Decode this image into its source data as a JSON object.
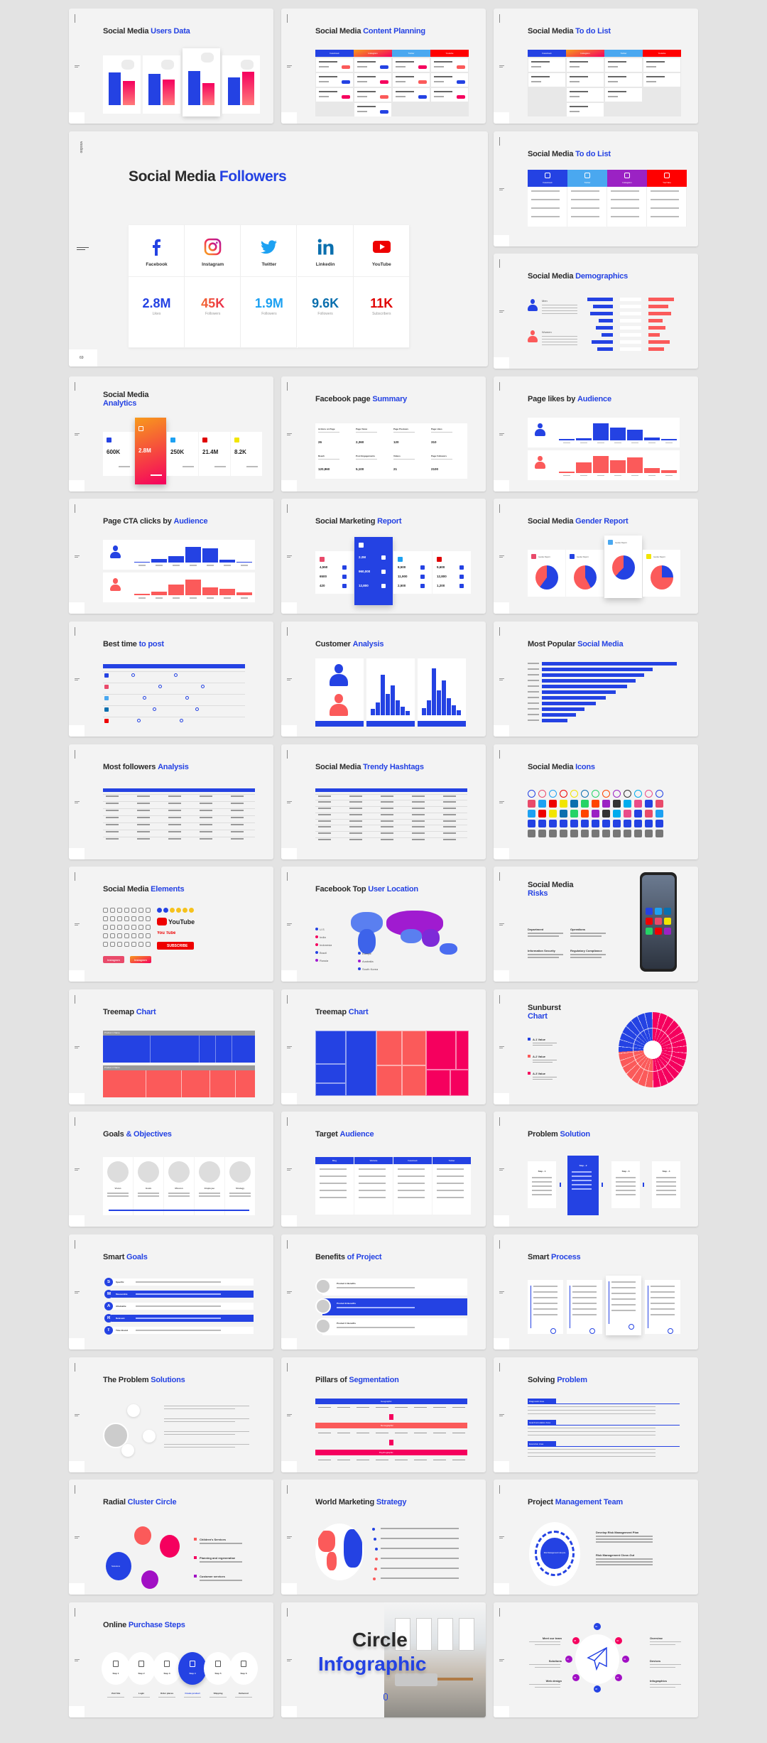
{
  "colors": {
    "blue": "#2442e3",
    "red": "#fb5a5a",
    "pink": "#f5005e",
    "purple": "#a10fc4",
    "light_blue": "#4aa8f0",
    "youtube": "#ee0000",
    "background": "#e3e3e3",
    "slide": "#f3f3f3"
  },
  "featured": {
    "brand": "voodoo",
    "page_number": "69",
    "title": [
      "Social Media ",
      "Followers"
    ],
    "networks": [
      {
        "name": "Facebook",
        "value": "2.8M",
        "unit": "Likes",
        "icon": "facebook-icon",
        "color": "#2442e3"
      },
      {
        "name": "Instagram",
        "value": "45K",
        "unit": "Followers",
        "icon": "instagram-icon",
        "color": "#f2473f"
      },
      {
        "name": "Twitter",
        "value": "1.9M",
        "unit": "Followers",
        "icon": "twitter-icon",
        "color": "#1da1f2"
      },
      {
        "name": "Linkedin",
        "value": "9.6K",
        "unit": "Followers",
        "icon": "linkedin-icon",
        "color": "#0a6fae"
      },
      {
        "name": "YouTube",
        "value": "11K",
        "unit": "Subscribers",
        "icon": "youtube-icon",
        "color": "#e00000"
      }
    ]
  },
  "slides": [
    {
      "type": "users",
      "title": [
        "Social Media ",
        "Users Data"
      ],
      "levels": [
        [
          0.82,
          0.6
        ],
        [
          0.78,
          0.64
        ],
        [
          0.85,
          0.55
        ],
        [
          0.7,
          0.84
        ]
      ]
    },
    {
      "type": "kanban",
      "title": [
        "Social Media ",
        "Content Planning"
      ],
      "headers": [
        "Facebook",
        "Instagram",
        "Twitter",
        "Youtube"
      ],
      "cards": [
        3,
        4,
        3,
        3
      ],
      "badges": true
    },
    {
      "type": "kanban",
      "title": [
        "Social Media ",
        "To do List"
      ],
      "headers": [
        "Facebook",
        "Instagram",
        "Twitter",
        "Youtube"
      ],
      "cards": [
        2,
        4,
        3,
        2
      ],
      "badges": false
    },
    {
      "type": "featured"
    },
    {
      "type": "todo2",
      "title": [
        "Social Media ",
        "To do List"
      ],
      "headers": [
        "Facebook",
        "Twitter",
        "Instagram",
        "YouTube"
      ]
    },
    {
      "type": "demographics",
      "title": [
        "Social Media ",
        "Demographics"
      ],
      "labels": [
        "Men",
        "Women"
      ],
      "levels": [
        0.9,
        0.7,
        0.8,
        0.5,
        0.6,
        0.4,
        0.75,
        0.55
      ]
    },
    {
      "type": "analytics",
      "title": [
        "Social Media ",
        "Analytics"
      ],
      "values": [
        "600K",
        "2.8M",
        "250K",
        "21.4M",
        "8.2K"
      ],
      "colors": [
        "#2442e3",
        "grad",
        "#1da1f2",
        "#e00000",
        "#f2e500"
      ]
    },
    {
      "type": "summary",
      "title": [
        "Facebook page ",
        "Summary"
      ],
      "labels": [
        "Actions on Page",
        "Page Views",
        "Page Previews",
        "Page Likes",
        "Reach",
        "Post Engagements",
        "Videos",
        "Page Followers"
      ],
      "values": [
        "26",
        "2,360",
        "120",
        "310",
        "120,860",
        "5,100",
        "21",
        "2100"
      ]
    },
    {
      "type": "audience",
      "title": [
        "Page likes by ",
        "Audience"
      ],
      "male": [
        0.05,
        0.1,
        0.9,
        0.7,
        0.58,
        0.15,
        0.05
      ],
      "female": [
        0.08,
        0.55,
        0.9,
        0.7,
        0.85,
        0.28,
        0.15
      ]
    },
    {
      "type": "audience",
      "title": [
        "Page CTA clicks by ",
        "Audience"
      ],
      "male": [
        0.04,
        0.2,
        0.35,
        0.85,
        0.8,
        0.18,
        0.04
      ],
      "female": [
        0.1,
        0.22,
        0.6,
        0.85,
        0.45,
        0.35,
        0.18
      ]
    },
    {
      "type": "report",
      "title": [
        "Social Marketing ",
        "Report"
      ],
      "values": [
        [
          "4,550",
          "6500",
          "420"
        ],
        [
          "2.2M",
          "960,000",
          "12,800"
        ],
        [
          "8,500",
          "11,900",
          "2,500"
        ],
        [
          "9,600",
          "12,800",
          "1,200"
        ]
      ],
      "colors": [
        "#e94a6a",
        "#ffffff",
        "#1da1f2",
        "#e00000"
      ]
    },
    {
      "type": "gender",
      "title": [
        "Social Media ",
        "Gender Report"
      ],
      "pies": [
        0.6,
        0.42,
        0.62,
        0.25
      ],
      "label": "Gender Report"
    },
    {
      "type": "besttime",
      "title": [
        "Best time ",
        "to post"
      ]
    },
    {
      "type": "customer",
      "title": [
        "Customer ",
        "Analysis"
      ]
    },
    {
      "type": "hbars",
      "title": [
        "Most Popular ",
        "Social Media"
      ],
      "levels": [
        0.95,
        0.78,
        0.72,
        0.66,
        0.6,
        0.52,
        0.45,
        0.38,
        0.3,
        0.24,
        0.18
      ]
    },
    {
      "type": "table",
      "title": [
        "Most followers ",
        "Analysis"
      ],
      "rows": 7
    },
    {
      "type": "table",
      "title": [
        "Social Media ",
        "Trendy Hashtags"
      ],
      "rows": 8
    },
    {
      "type": "icons",
      "title": [
        "Social Media ",
        "Icons"
      ]
    },
    {
      "type": "elements",
      "title": [
        "Social Media ",
        "Elements"
      ],
      "labels": [
        "YouTube",
        "You Tube",
        "SUBSCRIBE",
        "Instagram",
        "Instagram"
      ]
    },
    {
      "type": "map",
      "title": [
        "Facebook Top ",
        "User Location"
      ],
      "legend": [
        "U.S",
        "India",
        "Indonesia",
        "Brazil",
        "Russia",
        "Europe",
        "Australia",
        "South Korea"
      ]
    },
    {
      "type": "risks",
      "title": [
        "Social Media ",
        "Risks"
      ],
      "headings": [
        "Department",
        "Operations",
        "Information Security",
        "Regulatory Compliance"
      ]
    },
    {
      "type": "treemap1",
      "title": [
        "Treemap ",
        "Chart"
      ],
      "headers": [
        "Product 1 Name",
        "Product 2 Name"
      ]
    },
    {
      "type": "treemap2",
      "title": [
        "Treemap ",
        "Chart"
      ]
    },
    {
      "type": "sunburst",
      "title": [
        "Sunburst ",
        "Chart"
      ],
      "legend": [
        "A-1 Value",
        "A-2 Value",
        "A-3 Value"
      ]
    },
    {
      "type": "goals",
      "title": [
        "Goals ",
        "& Objectives"
      ],
      "labels": [
        "Vision",
        "Goals",
        "Mission",
        "Employee",
        "Strategy"
      ]
    },
    {
      "type": "target",
      "title": [
        "Target ",
        "Audience"
      ],
      "headers": [
        "Blog",
        "Website",
        "Facebook",
        "Twitter"
      ]
    },
    {
      "type": "problem",
      "title": [
        "Problem ",
        "Solution"
      ],
      "labels": [
        "Step - 1",
        "Step - 2",
        "Step - 3",
        "Step - 4"
      ]
    },
    {
      "type": "smartgoals",
      "title": [
        "Smart ",
        "Goals"
      ],
      "letters": [
        "S",
        "M",
        "A",
        "R",
        "T"
      ],
      "labels": [
        "Specific",
        "Measurable",
        "Attainable",
        "Relevant",
        "Time Bound"
      ]
    },
    {
      "type": "benefits",
      "title": [
        "Benefits ",
        "of Project"
      ],
      "labels": [
        "Product A Benefits",
        "Product B Benefits",
        "Product C Benefits"
      ]
    },
    {
      "type": "smartprocess",
      "title": [
        "Smart ",
        "Process"
      ]
    },
    {
      "type": "problemsol",
      "title": [
        "The Problem ",
        "Solutions"
      ]
    },
    {
      "type": "pillars",
      "title": [
        "Pillars of ",
        "Segmentation"
      ],
      "labels": [
        "Geographic",
        "Demographic",
        "Psychographic"
      ]
    },
    {
      "type": "solving",
      "title": [
        "Solving ",
        "Problem"
      ],
      "labels": [
        "Diagnostic Area",
        "Goal Formulation Area",
        "Execution Area"
      ]
    },
    {
      "type": "radial",
      "title": [
        "Radial ",
        "Cluster Circle"
      ],
      "hub": "Solutions",
      "items": [
        "Children's Services",
        "Planning and regeneration",
        "Customer services"
      ]
    },
    {
      "type": "world",
      "title": [
        "World Marketing ",
        "Strategy"
      ]
    },
    {
      "type": "pm",
      "title": [
        "Project ",
        "Management Team"
      ],
      "hub": "Risk Management Lifecycle",
      "items": [
        "Develop Risk Management Plan",
        "Risk Management Close-Out"
      ]
    },
    {
      "type": "purchase",
      "title": [
        "Online ",
        "Purchase Steps"
      ],
      "steps": [
        "Step 1",
        "Step 2",
        "Step 3",
        "Step 4",
        "Step 5",
        "Step 6"
      ],
      "labels": [
        "Visit Site",
        "Login",
        "Order places",
        "Create product",
        "Shipping",
        "Delivered"
      ]
    },
    {
      "type": "circleinfo",
      "title": [
        "Circle",
        "Infographic"
      ]
    },
    {
      "type": "infographic",
      "numbers": [
        "01",
        "02",
        "03",
        "04",
        "05",
        "06",
        "07",
        "08"
      ],
      "labels": [
        "Meet our team",
        "Solutions",
        "Web design",
        "Overview",
        "Devices",
        "Infographics"
      ]
    }
  ]
}
